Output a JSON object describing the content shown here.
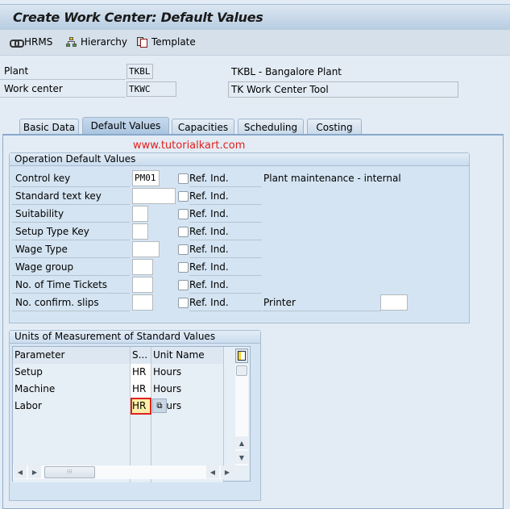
{
  "window": {
    "title": "Create Work Center: Default Values"
  },
  "toolbar": {
    "items": [
      {
        "label": "HRMS",
        "icon": "chain-link-icon"
      },
      {
        "label": "Hierarchy",
        "icon": "hierarchy-icon"
      },
      {
        "label": "Template",
        "icon": "template-icon"
      }
    ]
  },
  "header": {
    "plant_label": "Plant",
    "plant_value": "TKBL",
    "plant_description": "TKBL - Bangalore Plant",
    "work_center_label": "Work center",
    "work_center_value": "TKWC",
    "work_center_description": "TK Work Center Tool"
  },
  "tabs": [
    {
      "label": "Basic Data",
      "active": false
    },
    {
      "label": "Default Values",
      "active": true
    },
    {
      "label": "Capacities",
      "active": false
    },
    {
      "label": "Scheduling",
      "active": false
    },
    {
      "label": "Costing",
      "active": false
    }
  ],
  "watermark": "www.tutorialkart.com",
  "operation_defaults": {
    "title": "Operation Default Values",
    "ref_ind_label": "Ref. Ind.",
    "rows": [
      {
        "label": "Control key",
        "value": "PM01",
        "ref_checked": false
      },
      {
        "label": "Standard text key",
        "value": "",
        "ref_checked": false
      },
      {
        "label": "Suitability",
        "value": "",
        "ref_checked": false
      },
      {
        "label": "Setup Type Key",
        "value": "",
        "ref_checked": false
      },
      {
        "label": "Wage Type",
        "value": "",
        "ref_checked": false
      },
      {
        "label": "Wage group",
        "value": "",
        "ref_checked": false
      },
      {
        "label": "No. of Time Tickets",
        "value": "",
        "ref_checked": false
      },
      {
        "label": "No. confirm. slips",
        "value": "",
        "ref_checked": false
      }
    ],
    "control_key_description": "Plant maintenance - internal",
    "printer_label": "Printer",
    "printer_value": ""
  },
  "units_of_measurement": {
    "title": "Units of Measurement of Standard Values",
    "columns": [
      "Parameter",
      "S...",
      "Unit Name"
    ],
    "rows": [
      {
        "parameter": "Setup",
        "unit": "HR",
        "unit_name": "Hours"
      },
      {
        "parameter": "Machine",
        "unit": "HR",
        "unit_name": "Hours"
      },
      {
        "parameter": "Labor",
        "unit": "HR",
        "unit_name": "Hours"
      }
    ]
  }
}
